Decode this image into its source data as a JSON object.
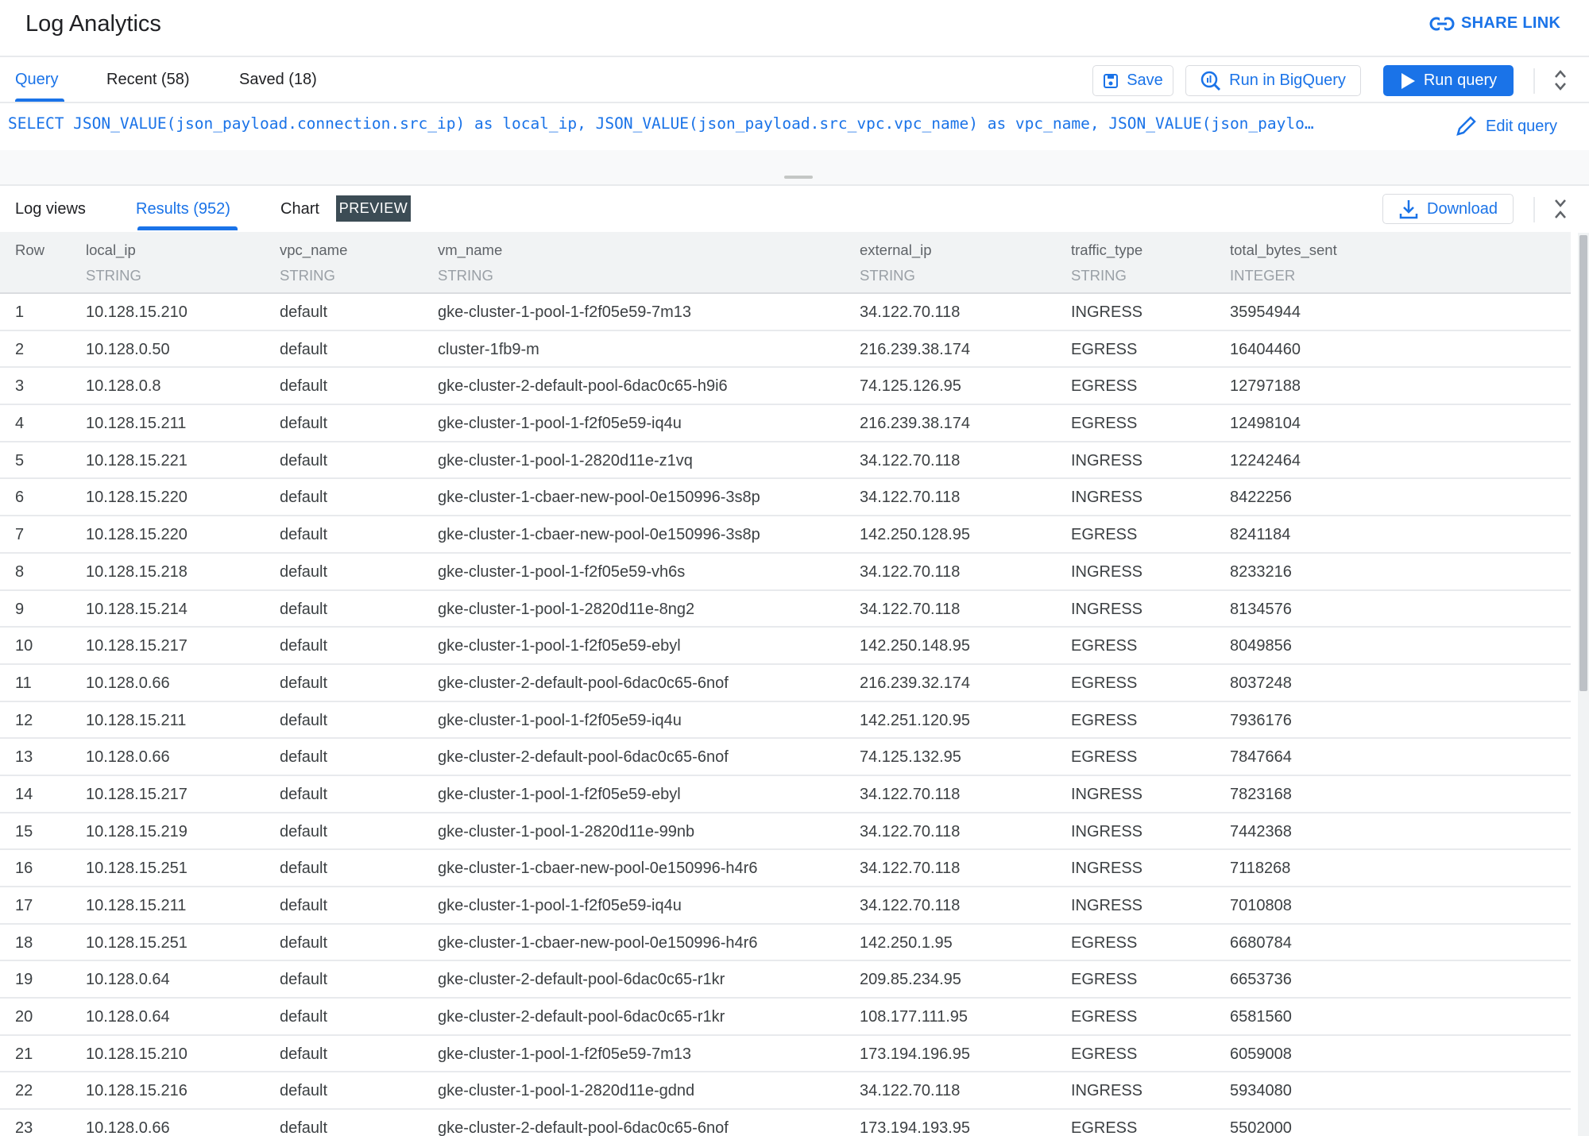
{
  "header": {
    "title": "Log Analytics",
    "share_label": "SHARE LINK"
  },
  "query_tabs": [
    {
      "label": "Query",
      "active": true
    },
    {
      "label": "Recent (58)"
    },
    {
      "label": "Saved (18)"
    }
  ],
  "toolbar": {
    "save_label": "Save",
    "bigquery_label": "Run in BigQuery",
    "run_label": "Run query",
    "accent": "#1a73e8"
  },
  "query": {
    "sql": "SELECT JSON_VALUE(json_payload.connection.src_ip) as local_ip, JSON_VALUE(json_payload.src_vpc.vpc_name) as vpc_name, JSON_VALUE(json_paylo…",
    "edit_label": "Edit query"
  },
  "results_tabs": [
    {
      "label": "Log views"
    },
    {
      "label": "Results (952)",
      "active": true
    },
    {
      "label": "Chart",
      "badge": "PREVIEW"
    }
  ],
  "download_label": "Download",
  "table": {
    "columns": [
      {
        "name": "Row",
        "type": ""
      },
      {
        "name": "local_ip",
        "type": "STRING"
      },
      {
        "name": "vpc_name",
        "type": "STRING"
      },
      {
        "name": "vm_name",
        "type": "STRING"
      },
      {
        "name": "external_ip",
        "type": "STRING"
      },
      {
        "name": "traffic_type",
        "type": "STRING"
      },
      {
        "name": "total_bytes_sent",
        "type": "INTEGER"
      }
    ],
    "rows": [
      [
        "1",
        "10.128.15.210",
        "default",
        "gke-cluster-1-pool-1-f2f05e59-7m13",
        "34.122.70.118",
        "INGRESS",
        "35954944"
      ],
      [
        "2",
        "10.128.0.50",
        "default",
        "cluster-1fb9-m",
        "216.239.38.174",
        "EGRESS",
        "16404460"
      ],
      [
        "3",
        "10.128.0.8",
        "default",
        "gke-cluster-2-default-pool-6dac0c65-h9i6",
        "74.125.126.95",
        "EGRESS",
        "12797188"
      ],
      [
        "4",
        "10.128.15.211",
        "default",
        "gke-cluster-1-pool-1-f2f05e59-iq4u",
        "216.239.38.174",
        "EGRESS",
        "12498104"
      ],
      [
        "5",
        "10.128.15.221",
        "default",
        "gke-cluster-1-pool-1-2820d11e-z1vq",
        "34.122.70.118",
        "INGRESS",
        "12242464"
      ],
      [
        "6",
        "10.128.15.220",
        "default",
        "gke-cluster-1-cbaer-new-pool-0e150996-3s8p",
        "34.122.70.118",
        "INGRESS",
        "8422256"
      ],
      [
        "7",
        "10.128.15.220",
        "default",
        "gke-cluster-1-cbaer-new-pool-0e150996-3s8p",
        "142.250.128.95",
        "EGRESS",
        "8241184"
      ],
      [
        "8",
        "10.128.15.218",
        "default",
        "gke-cluster-1-pool-1-f2f05e59-vh6s",
        "34.122.70.118",
        "INGRESS",
        "8233216"
      ],
      [
        "9",
        "10.128.15.214",
        "default",
        "gke-cluster-1-pool-1-2820d11e-8ng2",
        "34.122.70.118",
        "INGRESS",
        "8134576"
      ],
      [
        "10",
        "10.128.15.217",
        "default",
        "gke-cluster-1-pool-1-f2f05e59-ebyl",
        "142.250.148.95",
        "EGRESS",
        "8049856"
      ],
      [
        "11",
        "10.128.0.66",
        "default",
        "gke-cluster-2-default-pool-6dac0c65-6nof",
        "216.239.32.174",
        "EGRESS",
        "8037248"
      ],
      [
        "12",
        "10.128.15.211",
        "default",
        "gke-cluster-1-pool-1-f2f05e59-iq4u",
        "142.251.120.95",
        "EGRESS",
        "7936176"
      ],
      [
        "13",
        "10.128.0.66",
        "default",
        "gke-cluster-2-default-pool-6dac0c65-6nof",
        "74.125.132.95",
        "EGRESS",
        "7847664"
      ],
      [
        "14",
        "10.128.15.217",
        "default",
        "gke-cluster-1-pool-1-f2f05e59-ebyl",
        "34.122.70.118",
        "INGRESS",
        "7823168"
      ],
      [
        "15",
        "10.128.15.219",
        "default",
        "gke-cluster-1-pool-1-2820d11e-99nb",
        "34.122.70.118",
        "INGRESS",
        "7442368"
      ],
      [
        "16",
        "10.128.15.251",
        "default",
        "gke-cluster-1-cbaer-new-pool-0e150996-h4r6",
        "34.122.70.118",
        "INGRESS",
        "7118268"
      ],
      [
        "17",
        "10.128.15.211",
        "default",
        "gke-cluster-1-pool-1-f2f05e59-iq4u",
        "34.122.70.118",
        "INGRESS",
        "7010808"
      ],
      [
        "18",
        "10.128.15.251",
        "default",
        "gke-cluster-1-cbaer-new-pool-0e150996-h4r6",
        "142.250.1.95",
        "EGRESS",
        "6680784"
      ],
      [
        "19",
        "10.128.0.64",
        "default",
        "gke-cluster-2-default-pool-6dac0c65-r1kr",
        "209.85.234.95",
        "EGRESS",
        "6653736"
      ],
      [
        "20",
        "10.128.0.64",
        "default",
        "gke-cluster-2-default-pool-6dac0c65-r1kr",
        "108.177.111.95",
        "EGRESS",
        "6581560"
      ],
      [
        "21",
        "10.128.15.210",
        "default",
        "gke-cluster-1-pool-1-f2f05e59-7m13",
        "173.194.196.95",
        "EGRESS",
        "6059008"
      ],
      [
        "22",
        "10.128.15.216",
        "default",
        "gke-cluster-1-pool-1-2820d11e-gdnd",
        "34.122.70.118",
        "INGRESS",
        "5934080"
      ],
      [
        "23",
        "10.128.0.66",
        "default",
        "gke-cluster-2-default-pool-6dac0c65-6nof",
        "173.194.193.95",
        "EGRESS",
        "5502000"
      ]
    ]
  }
}
